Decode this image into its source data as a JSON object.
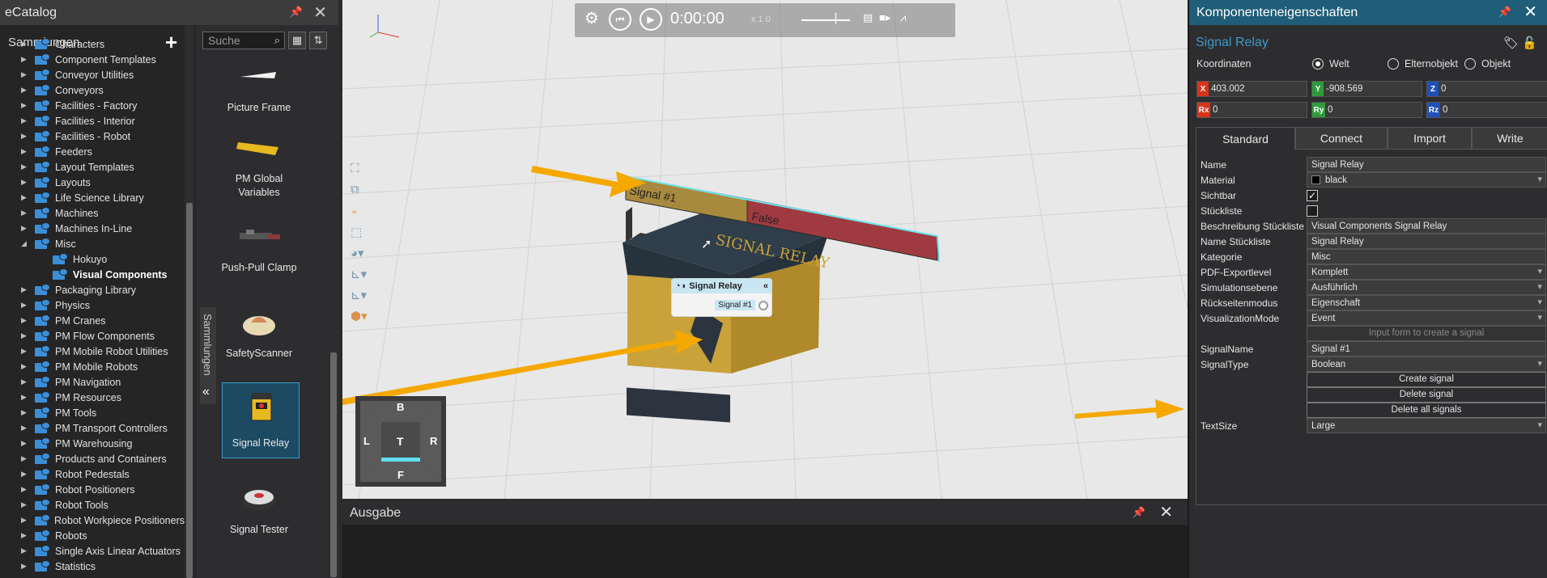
{
  "catalog": {
    "title": "eCatalog",
    "collections_label": "Sammlungen",
    "search_placeholder": "Suche",
    "side_tab_label": "Sammlungen",
    "tree": [
      {
        "label": "Characters",
        "level": 0,
        "expanded": false
      },
      {
        "label": "Component Templates",
        "level": 0,
        "expanded": false
      },
      {
        "label": "Conveyor Utilities",
        "level": 0,
        "expanded": false
      },
      {
        "label": "Conveyors",
        "level": 0,
        "expanded": false
      },
      {
        "label": "Facilities - Factory",
        "level": 0,
        "expanded": false
      },
      {
        "label": "Facilities - Interior",
        "level": 0,
        "expanded": false
      },
      {
        "label": "Facilities - Robot",
        "level": 0,
        "expanded": false
      },
      {
        "label": "Feeders",
        "level": 0,
        "expanded": false
      },
      {
        "label": "Layout Templates",
        "level": 0,
        "expanded": false
      },
      {
        "label": "Layouts",
        "level": 0,
        "expanded": false
      },
      {
        "label": "Life Science Library",
        "level": 0,
        "expanded": false
      },
      {
        "label": "Machines",
        "level": 0,
        "expanded": false
      },
      {
        "label": "Machines In-Line",
        "level": 0,
        "expanded": false
      },
      {
        "label": "Misc",
        "level": 0,
        "expanded": true
      },
      {
        "label": "Hokuyo",
        "level": 1,
        "expanded": false
      },
      {
        "label": "Visual Components",
        "level": 1,
        "expanded": false,
        "selected": true
      },
      {
        "label": "Packaging Library",
        "level": 0,
        "expanded": false
      },
      {
        "label": "Physics",
        "level": 0,
        "expanded": false
      },
      {
        "label": "PM Cranes",
        "level": 0,
        "expanded": false
      },
      {
        "label": "PM Flow Components",
        "level": 0,
        "expanded": false
      },
      {
        "label": "PM Mobile Robot Utilities",
        "level": 0,
        "expanded": false
      },
      {
        "label": "PM Mobile Robots",
        "level": 0,
        "expanded": false
      },
      {
        "label": "PM Navigation",
        "level": 0,
        "expanded": false
      },
      {
        "label": "PM Resources",
        "level": 0,
        "expanded": false
      },
      {
        "label": "PM Tools",
        "level": 0,
        "expanded": false
      },
      {
        "label": "PM Transport Controllers",
        "level": 0,
        "expanded": false
      },
      {
        "label": "PM Warehousing",
        "level": 0,
        "expanded": false
      },
      {
        "label": "Products and Containers",
        "level": 0,
        "expanded": false
      },
      {
        "label": "Robot Pedestals",
        "level": 0,
        "expanded": false
      },
      {
        "label": "Robot Positioners",
        "level": 0,
        "expanded": false
      },
      {
        "label": "Robot Tools",
        "level": 0,
        "expanded": false
      },
      {
        "label": "Robot Workpiece Positioners",
        "level": 0,
        "expanded": false
      },
      {
        "label": "Robots",
        "level": 0,
        "expanded": false
      },
      {
        "label": "Single Axis Linear Actuators",
        "level": 0,
        "expanded": false
      },
      {
        "label": "Statistics",
        "level": 0,
        "expanded": false
      }
    ],
    "items": [
      {
        "label": "Picture Frame"
      },
      {
        "label": "PM Global Variables"
      },
      {
        "label": "Push-Pull Clamp"
      },
      {
        "label": "SafetyScanner"
      },
      {
        "label": "Signal Relay",
        "selected": true
      },
      {
        "label": "Signal Tester"
      }
    ]
  },
  "viewport": {
    "time": "0:00:00",
    "speed": "x 1.0",
    "relay_label": "SIGNAL RELAY",
    "signal_bar_left": "Signal #1",
    "signal_bar_right": "False",
    "popup_title": "Signal Relay",
    "popup_signal": "Signal #1",
    "viewcube": {
      "top": "B",
      "left": "L",
      "center": "T",
      "right": "R",
      "bottom": "F"
    }
  },
  "output": {
    "title": "Ausgabe"
  },
  "props": {
    "title": "Komponenteneigenschaften",
    "component_name": "Signal Relay",
    "coord_label": "Koordinaten",
    "coord_options": [
      "Welt",
      "Elternobjekt",
      "Objekt"
    ],
    "coord_selected": "Welt",
    "x": "403.002",
    "y": "-908.569",
    "z": "0",
    "rx": "0",
    "ry": "0",
    "rz": "0",
    "tabs": [
      "Standard",
      "Connect",
      "Import",
      "Write"
    ],
    "active_tab": "Standard",
    "rows": {
      "name": {
        "label": "Name",
        "value": "Signal Relay"
      },
      "material": {
        "label": "Material",
        "value": "black"
      },
      "visible": {
        "label": "Sichtbar",
        "checked": true
      },
      "bom": {
        "label": "Stückliste",
        "checked": false
      },
      "bom_desc": {
        "label": "Beschreibung Stückliste",
        "value": "Visual Components Signal Relay"
      },
      "bom_name": {
        "label": "Name Stückliste",
        "value": "Signal Relay"
      },
      "category": {
        "label": "Kategorie",
        "value": "Misc"
      },
      "pdf": {
        "label": "PDF-Exportlevel",
        "value": "Komplett"
      },
      "sim": {
        "label": "Simulationsebene",
        "value": "Ausführlich"
      },
      "back": {
        "label": "Rückseitenmodus",
        "value": "Eigenschaft"
      },
      "vis_mode": {
        "label": "VisualizationMode",
        "value": "Event"
      },
      "input_form": {
        "label": "Input form to create a signal"
      },
      "signal_name": {
        "label": "SignalName",
        "value": "Signal #1"
      },
      "signal_type": {
        "label": "SignalType",
        "value": "Boolean"
      },
      "create": {
        "label": "Create signal"
      },
      "delete": {
        "label": "Delete signal"
      },
      "delete_all": {
        "label": "Delete all signals"
      },
      "text_size": {
        "label": "TextSize",
        "value": "Large"
      }
    }
  },
  "colors": {
    "accent": "#1f5d78",
    "arrow": "#f5a800",
    "relay": "#c9a23a",
    "bar_red": "#a0393f"
  }
}
